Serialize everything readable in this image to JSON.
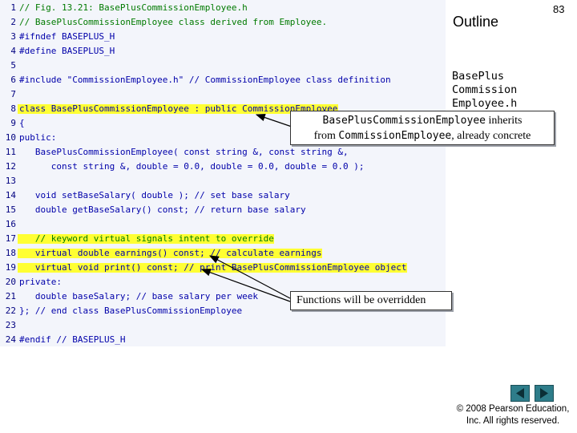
{
  "code": [
    {
      "n": "1",
      "t": "// Fig. 13.21: BasePlusCommissionEmployee.h",
      "kind": "cm"
    },
    {
      "n": "2",
      "t": "// BasePlusCommissionEmployee class derived from Employee.",
      "kind": "cm"
    },
    {
      "n": "3",
      "t": "#ifndef BASEPLUS_H",
      "kind": "kw"
    },
    {
      "n": "4",
      "t": "#define BASEPLUS_H",
      "kind": "kw"
    },
    {
      "n": "5",
      "t": "",
      "kind": ""
    },
    {
      "n": "6",
      "t": "#include \"CommissionEmployee.h\" // CommissionEmployee class definition",
      "kind": "kw"
    },
    {
      "n": "7",
      "t": "",
      "kind": ""
    },
    {
      "n": "8",
      "t": "class BasePlusCommissionEmployee : public CommissionEmployee",
      "kind": "kw",
      "hl": true
    },
    {
      "n": "9",
      "t": "{",
      "kind": "kw"
    },
    {
      "n": "10",
      "t": "public:",
      "kind": "kw"
    },
    {
      "n": "11",
      "t": "   BasePlusCommissionEmployee( const string &, const string &,",
      "kind": "kw"
    },
    {
      "n": "12",
      "t": "      const string &, double = 0.0, double = 0.0, double = 0.0 );",
      "kind": "kw"
    },
    {
      "n": "13",
      "t": "",
      "kind": ""
    },
    {
      "n": "14",
      "t": "   void setBaseSalary( double ); // set base salary",
      "kind": "kw"
    },
    {
      "n": "15",
      "t": "   double getBaseSalary() const; // return base salary",
      "kind": "kw"
    },
    {
      "n": "16",
      "t": "",
      "kind": ""
    },
    {
      "n": "17",
      "t": "   // keyword virtual signals intent to override",
      "kind": "cm",
      "hl": true
    },
    {
      "n": "18",
      "t": "   virtual double earnings() const; // calculate earnings",
      "kind": "kw",
      "hl": true
    },
    {
      "n": "19",
      "t": "   virtual void print() const; // print BasePlusCommissionEmployee object",
      "kind": "kw",
      "hl": true
    },
    {
      "n": "20",
      "t": "private:",
      "kind": "kw"
    },
    {
      "n": "21",
      "t": "   double baseSalary; // base salary per week",
      "kind": "kw"
    },
    {
      "n": "22",
      "t": "}; // end class BasePlusCommissionEmployee",
      "kind": "kw"
    },
    {
      "n": "23",
      "t": "",
      "kind": ""
    },
    {
      "n": "24",
      "t": "#endif // BASEPLUS_H",
      "kind": "kw"
    }
  ],
  "sidebar": {
    "outline": "Outline",
    "page_number": "83",
    "file_line1": "BasePlus",
    "file_line2": "Commission",
    "file_line3": "Employee.h"
  },
  "callouts": {
    "inherits_code1": "BasePlusCommissionEmployee",
    "inherits_text1": " inherits",
    "inherits_text2": "from ",
    "inherits_code2": "CommissionEmployee",
    "inherits_text3": ", already concrete",
    "overridden": "Functions will be overridden"
  },
  "footer": {
    "copyright_line1": "© 2008 Pearson Education,",
    "copyright_line2": "Inc.  All rights reserved."
  },
  "colors": {
    "highlight": "#ffff33",
    "keyword": "#0000aa",
    "comment": "#007a00",
    "nav_button": "#2e7d8a"
  },
  "icons": {
    "prev": "left-triangle-icon",
    "next": "right-triangle-icon"
  }
}
